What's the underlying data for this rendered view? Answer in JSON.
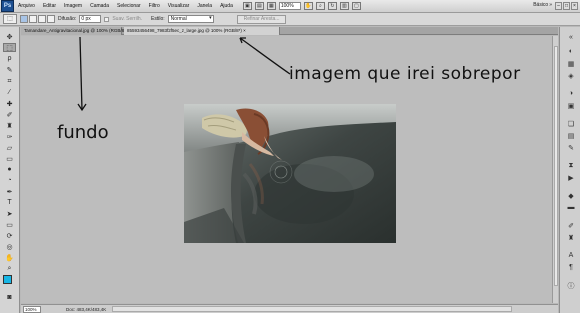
{
  "app": {
    "logo": "Ps"
  },
  "menu": [
    "Arquivo",
    "Editar",
    "Imagem",
    "Camada",
    "Selecionar",
    "Filtro",
    "Visualizar",
    "Janela",
    "Ajuda"
  ],
  "menubar": {
    "zoom": "100%",
    "workspace": "Básico"
  },
  "options": {
    "feather_label": "Difusão:",
    "feather_value": "0 px",
    "antialias_label": "Suav. Serrilh.",
    "style_label": "Estilo:",
    "style_value": "Normal",
    "refine_label": "Refinar Aresta..."
  },
  "tabs": [
    {
      "label": "Tamandare_Antigravitacional.jpg @ 100% (RGB/8) ×"
    },
    {
      "label": "85593456498_7983f2f5ec_z_large.jpg @ 100% (RGB/8*) ×"
    }
  ],
  "status": {
    "zoom": "100%",
    "doc": "Doc: 483,4K/483,4K"
  },
  "annotations": {
    "top": "imagem que irei sobrepor",
    "left": "fundo"
  },
  "colors": {
    "foreground": "#18b7e6",
    "background": "#ffffff",
    "canvas": "#bdbdbd"
  }
}
